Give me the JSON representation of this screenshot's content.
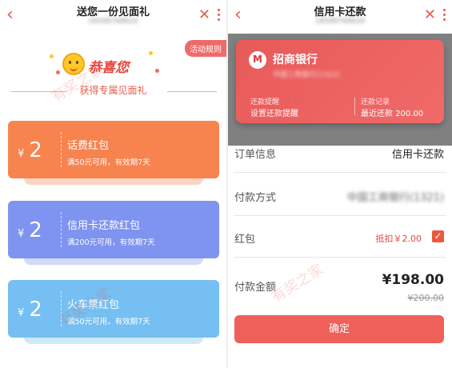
{
  "left": {
    "title": "送您一份见面礼",
    "subtitle_phone": "18598768620",
    "rules_label": "活动规则",
    "congrats_text": "恭喜您",
    "gift_heading": "获得专属见面礼",
    "coupons": [
      {
        "currency": "¥",
        "amount": "2",
        "name": "话费红包",
        "condition": "满50元可用，有效期7天",
        "color": "#f7834f"
      },
      {
        "currency": "¥",
        "amount": "2",
        "name": "信用卡还款红包",
        "condition": "满200元可用，有效期7天",
        "color": "#7f93f0"
      },
      {
        "currency": "¥",
        "amount": "2",
        "name": "火车票红包",
        "condition": "满50元可用，有效期7天",
        "color": "#75bff2"
      }
    ]
  },
  "right": {
    "title": "信用卡还款",
    "subtitle_phone": "18598768620",
    "card": {
      "bank_name": "招商银行",
      "account": "中国工商银行(1321)",
      "left_label": "还款提醒",
      "left_value": "设置还款提醒",
      "right_label": "还款记录",
      "right_value": "最近还款 200.00"
    },
    "rows": {
      "order_label": "订单信息",
      "order_value": "信用卡还款",
      "payment_label": "付款方式",
      "payment_value": "中国工商银行(1321)",
      "redpacket_label": "红包",
      "redpacket_value": "抵扣￥2.00",
      "amount_label": "付款金额"
    },
    "total": "¥198.00",
    "original": "¥200.00",
    "confirm_label": "确定"
  },
  "watermark": "有奖之家",
  "colors": {
    "accent": "#e85a4a",
    "button": "#f0605a"
  }
}
